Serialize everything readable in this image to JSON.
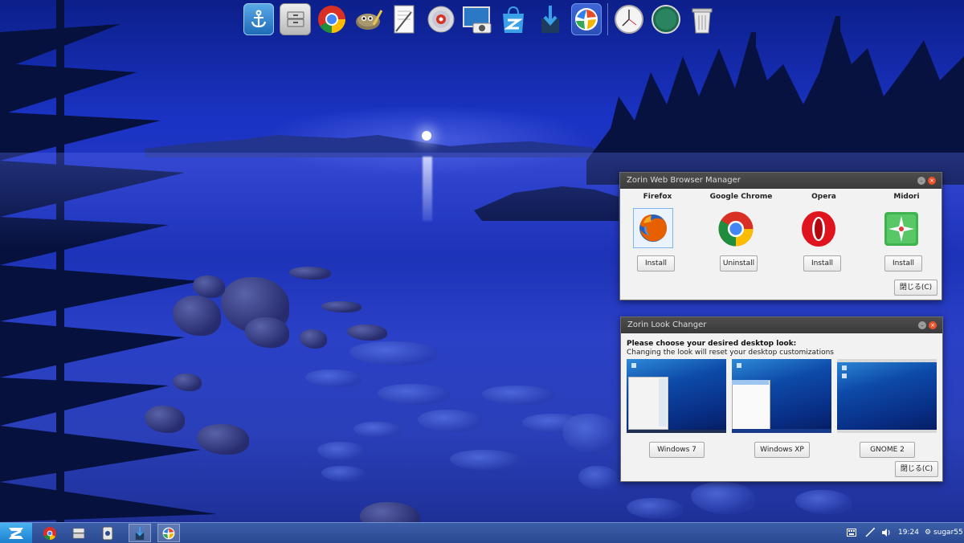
{
  "top_dock": {
    "icons": [
      {
        "name": "anchor-icon"
      },
      {
        "name": "file-manager-icon"
      },
      {
        "name": "chrome-icon"
      },
      {
        "name": "gimp-icon"
      },
      {
        "name": "text-editor-icon"
      },
      {
        "name": "disc-burner-icon"
      },
      {
        "name": "screenshot-icon"
      },
      {
        "name": "software-center-icon"
      },
      {
        "name": "install-icon"
      },
      {
        "name": "web-browser-manager-icon"
      },
      {
        "name": "clock-icon"
      },
      {
        "name": "workspace-icon"
      },
      {
        "name": "trash-icon"
      }
    ]
  },
  "browser_manager": {
    "title": "Zorin Web Browser Manager",
    "browsers": [
      {
        "name": "Firefox",
        "action": "Install"
      },
      {
        "name": "Google Chrome",
        "action": "Uninstall"
      },
      {
        "name": "Opera",
        "action": "Install"
      },
      {
        "name": "Midori",
        "action": "Install"
      }
    ],
    "close_label": "閉じる(C)"
  },
  "look_changer": {
    "title": "Zorin Look Changer",
    "heading": "Please choose your desired desktop look:",
    "subheading": "Changing the look will reset your desktop customizations",
    "looks": [
      {
        "label": "Windows 7"
      },
      {
        "label": "Windows XP"
      },
      {
        "label": "GNOME 2"
      }
    ],
    "close_label": "閉じる(C)"
  },
  "taskbar": {
    "clock": "19:24",
    "user": "sugar55"
  },
  "colors": {
    "accent": "#2a4a92",
    "close_button": "#e9522b"
  }
}
